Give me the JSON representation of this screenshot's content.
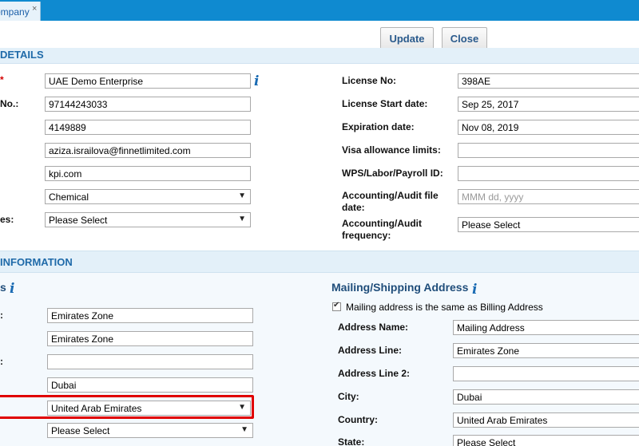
{
  "tab": {
    "label": "ompany",
    "close": "×"
  },
  "toolbar": {
    "update_label": "Update",
    "close_label": "Close"
  },
  "details": {
    "title": "DETAILS",
    "left": [
      {
        "label": "",
        "required": true,
        "value": "UAE Demo Enterprise",
        "info": "i"
      },
      {
        "label": "No.:",
        "value": "97144243033"
      },
      {
        "label": "",
        "value": "4149889"
      },
      {
        "label": "",
        "value": "aziza.israilova@finnetlimited.com"
      },
      {
        "label": "",
        "value": "kpi.com"
      },
      {
        "label": "",
        "value": "Chemical",
        "arrow": "▼"
      },
      {
        "label": "es:",
        "value": "Please Select",
        "arrow": "▼"
      }
    ],
    "right": [
      {
        "label": "License No:",
        "value": "398AE"
      },
      {
        "label": "License Start date:",
        "value": "Sep 25, 2017"
      },
      {
        "label": "Expiration date:",
        "value": "Nov 08, 2019"
      },
      {
        "label": "Visa allowance limits:",
        "value": ""
      },
      {
        "label": "WPS/Labor/Payroll ID:",
        "value": ""
      },
      {
        "label": "Accounting/Audit file date:",
        "placeholder": "MMM dd, yyyy"
      },
      {
        "label": "Accounting/Audit frequency:",
        "value": "Please Select"
      }
    ]
  },
  "information": {
    "title": "INFORMATION",
    "billing": {
      "heading": "s",
      "info": "i",
      "rows": [
        {
          "label": ":",
          "value": "Emirates Zone"
        },
        {
          "label": "",
          "value": "Emirates Zone"
        },
        {
          "label": ":",
          "value": ""
        },
        {
          "label": "",
          "value": "Dubai"
        },
        {
          "label": "",
          "value": "United Arab Emirates",
          "arrow": "▼"
        },
        {
          "label": "",
          "value": "Please Select",
          "arrow": "▼"
        }
      ]
    },
    "mailing": {
      "heading": "Mailing/Shipping Address",
      "info": "i",
      "same_label": "Mailing address is the same as Billing Address",
      "rows": [
        {
          "label": "Address Name:",
          "value": "Mailing Address"
        },
        {
          "label": "Address Line:",
          "value": "Emirates Zone"
        },
        {
          "label": "Address Line 2:",
          "value": ""
        },
        {
          "label": "City:",
          "value": "Dubai"
        },
        {
          "label": "Country:",
          "value": "United Arab Emirates"
        },
        {
          "label": "State:",
          "value": "Please Select"
        }
      ]
    }
  }
}
